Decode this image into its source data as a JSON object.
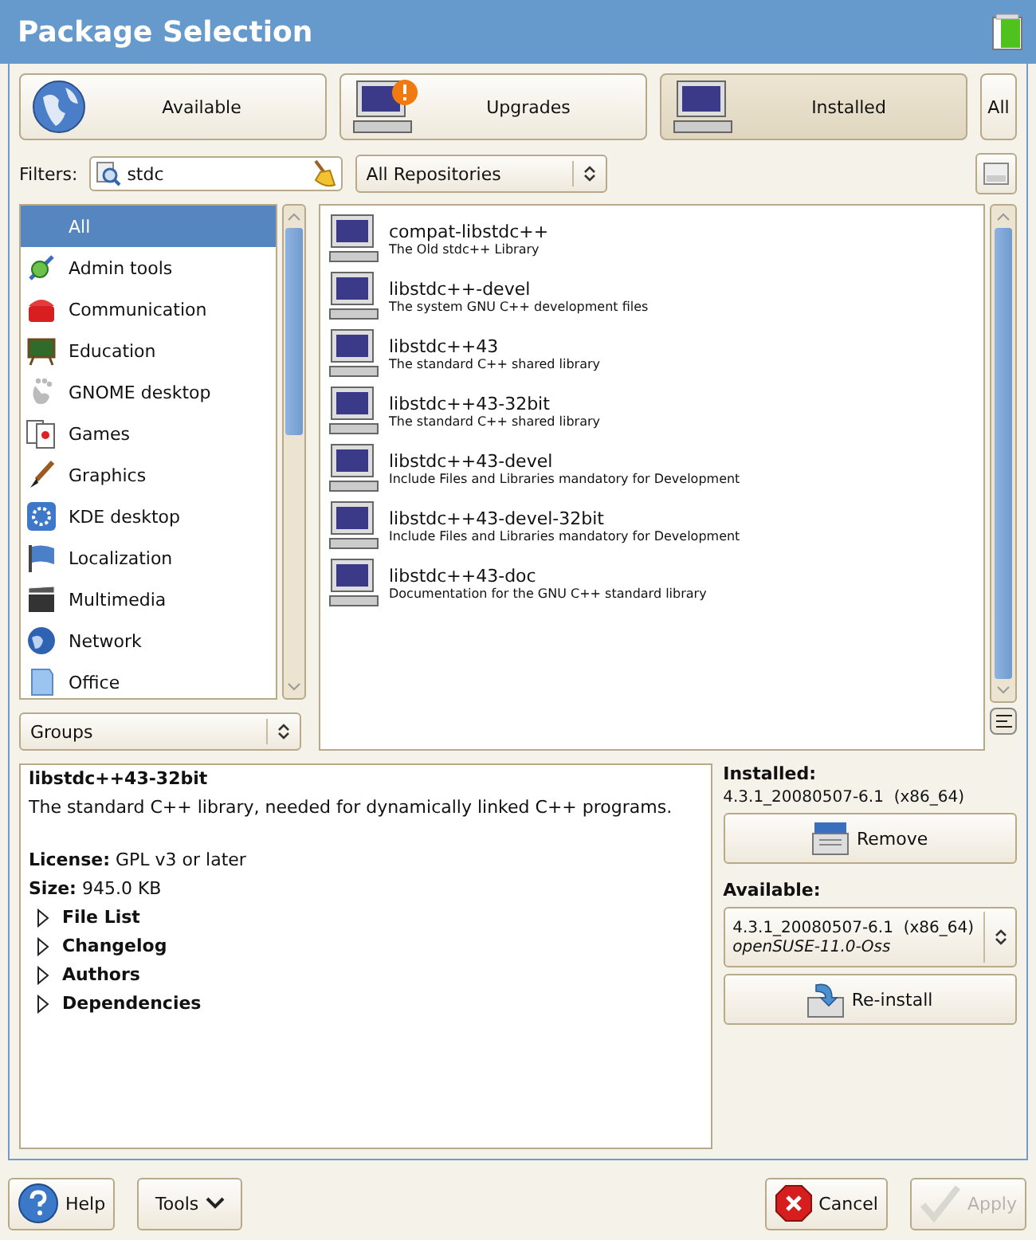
{
  "window": {
    "title": "Package Selection"
  },
  "views": [
    {
      "label": "Available",
      "selected": false,
      "kind": "globe"
    },
    {
      "label": "Upgrades",
      "selected": false,
      "kind": "upgrade"
    },
    {
      "label": "Installed",
      "selected": true,
      "kind": "computer"
    },
    {
      "label": "All",
      "selected": false,
      "kind": "text"
    }
  ],
  "filters": {
    "label": "Filters:",
    "search": {
      "value": "stdc"
    },
    "repository": "All Repositories"
  },
  "groups": [
    {
      "label": "All",
      "selected": true
    },
    {
      "label": "Admin tools",
      "selected": false
    },
    {
      "label": "Communication",
      "selected": false
    },
    {
      "label": "Education",
      "selected": false
    },
    {
      "label": "GNOME desktop",
      "selected": false
    },
    {
      "label": "Games",
      "selected": false
    },
    {
      "label": "Graphics",
      "selected": false
    },
    {
      "label": "KDE desktop",
      "selected": false
    },
    {
      "label": "Localization",
      "selected": false
    },
    {
      "label": "Multimedia",
      "selected": false
    },
    {
      "label": "Network",
      "selected": false
    },
    {
      "label": "Office",
      "selected": false
    }
  ],
  "group_selector": "Groups",
  "packages": [
    {
      "name": "compat-libstdc++",
      "summary": "The Old stdc++ Library"
    },
    {
      "name": "libstdc++-devel",
      "summary": "The system GNU C++ development files"
    },
    {
      "name": "libstdc++43",
      "summary": "The standard C++ shared library"
    },
    {
      "name": "libstdc++43-32bit",
      "summary": "The standard C++ shared library"
    },
    {
      "name": "libstdc++43-devel",
      "summary": "Include Files and Libraries mandatory for Development"
    },
    {
      "name": "libstdc++43-devel-32bit",
      "summary": "Include Files and Libraries mandatory for Development"
    },
    {
      "name": "libstdc++43-doc",
      "summary": "Documentation for the GNU C++ standard library"
    }
  ],
  "details": {
    "name": "libstdc++43-32bit",
    "description": "The standard C++ library, needed for dynamically linked C++ programs.",
    "fields": [
      {
        "label": "License:",
        "value": "GPL v3 or later"
      },
      {
        "label": "Size:",
        "value": "945.0 KB"
      }
    ],
    "sections": [
      {
        "label": "File List",
        "expanded": false
      },
      {
        "label": "Changelog",
        "expanded": false
      },
      {
        "label": "Authors",
        "expanded": false
      },
      {
        "label": "Dependencies",
        "expanded": false
      }
    ]
  },
  "installed": {
    "label": "Installed:",
    "version": "4.3.1_20080507-6.1  (x86_64)",
    "button": "Remove"
  },
  "available": {
    "label": "Available:",
    "version": "4.3.1_20080507-6.1  (x86_64)",
    "repository": "openSUSE-11.0-Oss",
    "button": "Re-install"
  },
  "footer": [
    {
      "label": "Help",
      "kind": "help",
      "disabled": false
    },
    {
      "label": "Tools",
      "kind": "menu",
      "disabled": false
    },
    {
      "label": "Cancel",
      "kind": "cancel",
      "disabled": false
    },
    {
      "label": "Apply",
      "kind": "apply",
      "disabled": true
    }
  ]
}
